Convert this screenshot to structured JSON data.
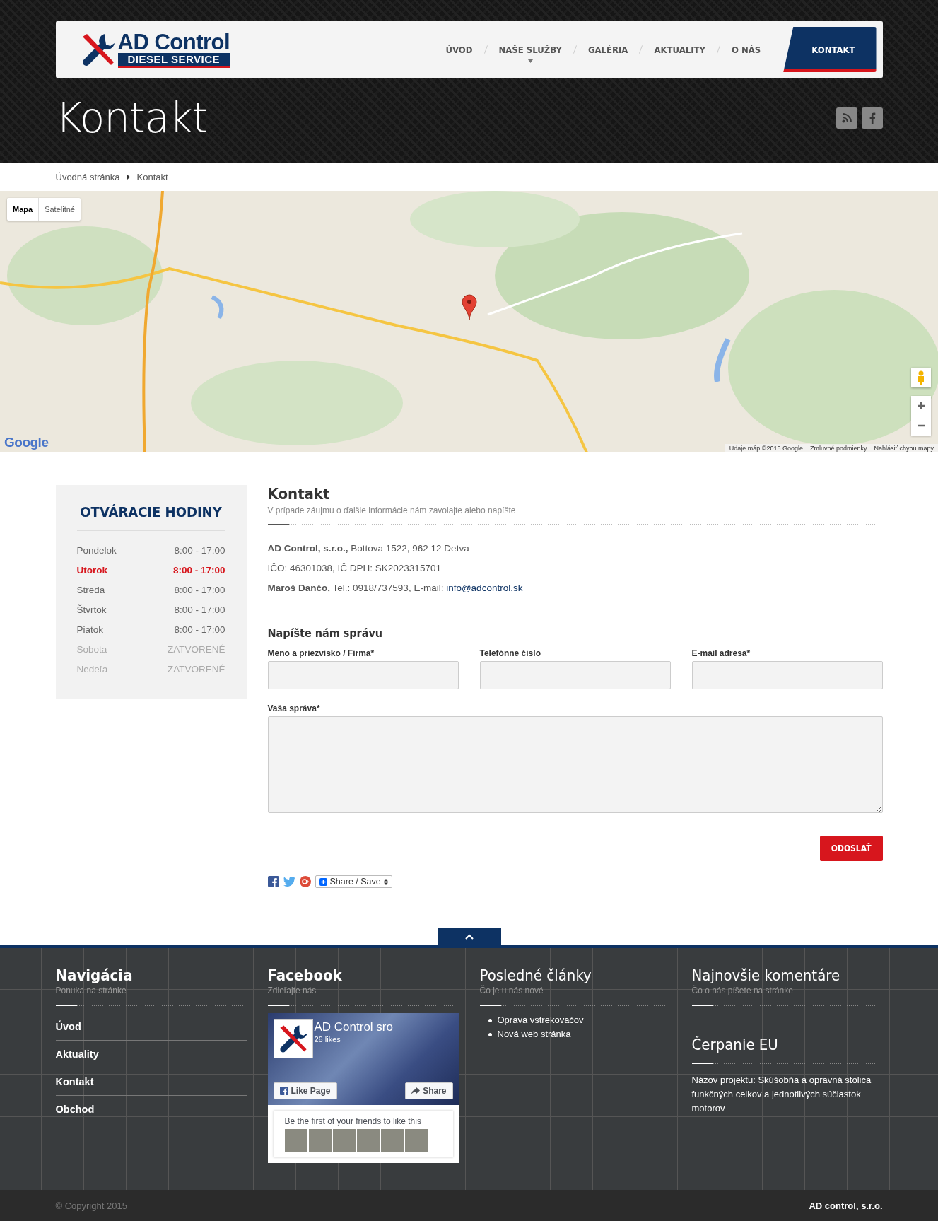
{
  "logo": {
    "line1": "AD Control",
    "line2": "DIESEL SERVICE"
  },
  "nav": [
    {
      "label": "ÚVOD",
      "selected": false,
      "dropdown": false
    },
    {
      "label": "NAŠE SLUŽBY",
      "selected": false,
      "dropdown": true
    },
    {
      "label": "GALÉRIA",
      "selected": false,
      "dropdown": false
    },
    {
      "label": "AKTUALITY",
      "selected": false,
      "dropdown": false
    },
    {
      "label": "O NÁS",
      "selected": false,
      "dropdown": false
    },
    {
      "label": "KONTAKT",
      "selected": true,
      "dropdown": false
    }
  ],
  "page_title": "Kontakt",
  "breadcrumb": [
    "Úvodná stránka",
    "Kontakt"
  ],
  "map": {
    "types": [
      {
        "label": "Mapa",
        "selected": true
      },
      {
        "label": "Satelitné",
        "selected": false
      }
    ],
    "logo": "Google",
    "attribution": [
      "Údaje máp ©2015 Google",
      "Zmluvné podmienky",
      "Nahlásiť chybu mapy"
    ]
  },
  "hours": {
    "title": "OTVÁRACIE HODINY",
    "rows": [
      {
        "day": "Pondelok",
        "time": "8:00 - 17:00",
        "kind": "open"
      },
      {
        "day": "Utorok",
        "time": "8:00 - 17:00",
        "kind": "today"
      },
      {
        "day": "Streda",
        "time": "8:00 - 17:00",
        "kind": "open"
      },
      {
        "day": "Štvrtok",
        "time": "8:00 - 17:00",
        "kind": "open"
      },
      {
        "day": "Piatok",
        "time": "8:00 - 17:00",
        "kind": "open"
      },
      {
        "day": "Sobota",
        "time": "ZATVORENÉ",
        "kind": "closed"
      },
      {
        "day": "Nedeľa",
        "time": "ZATVORENÉ",
        "kind": "closed"
      }
    ]
  },
  "contact": {
    "title": "Kontakt",
    "subtitle": "V prípade záujmu o ďalšie informácie nám zavolajte alebo napíšte",
    "lines": [
      {
        "text": "**AD Control, s.r.o.,** Bottova 1522, 962 12 Detva"
      },
      {
        "text": "IČO: 46301038, IČ DPH: SK2023315701"
      },
      {
        "text": "**Maroš Dančo,** Tel.: 0918/737593, E-mail: ",
        "link": "info@adcontrol.sk"
      }
    ]
  },
  "form": {
    "title": "Napíšte nám správu",
    "fields": [
      {
        "label": "Meno a priezvisko / Firma*"
      },
      {
        "label": "Telefónne číslo"
      },
      {
        "label": "E-mail adresa*"
      }
    ],
    "message_label": "Vaša správa*",
    "submit": "ODOSLAŤ"
  },
  "share": {
    "label": "Share / Save"
  },
  "footer": {
    "columns": [
      {
        "title": "Navigácia",
        "bold_title": true,
        "subtitle": "Ponuka na stránke",
        "links": [
          "Úvod",
          "Aktuality",
          "Kontakt",
          "Obchod"
        ]
      },
      {
        "title": "Facebook",
        "bold_title": true,
        "subtitle": "Zdieľajte nás",
        "facebook": {
          "page_name": "AD Control sro",
          "likes": "26 likes",
          "like_button": "Like Page",
          "share_button": "Share",
          "friends_text": "Be the first of your friends to like this"
        }
      },
      {
        "title": "Posledné **články**",
        "bold_title": false,
        "subtitle": "Čo je u nás nové",
        "articles": [
          "Oprava vstrekovačov",
          "Nová web stránka"
        ]
      },
      {
        "title": "Najnovšie **komentáre**",
        "bold_title": false,
        "subtitle": "Čo o nás píšete na stránke",
        "extra": {
          "title": "Čerpanie **EU**",
          "text": "Názov projektu: Skúšobňa a opravná stolica funkčných celkov a jednotlivých súčiastok motorov"
        }
      }
    ],
    "copyright": "© Copyright 2015",
    "company": "AD control, s.r.o."
  }
}
